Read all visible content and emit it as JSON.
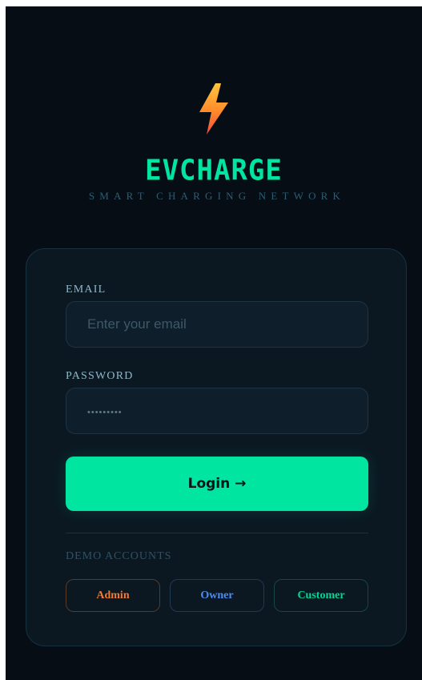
{
  "brand": {
    "logo_icon": "lightning-bolt-icon",
    "name": "EVCHARGE",
    "tagline": "SMART CHARGING NETWORK",
    "accent_color": "#00e5a0"
  },
  "login_form": {
    "email": {
      "label": "EMAIL",
      "value": "",
      "placeholder": "Enter your email"
    },
    "password": {
      "label": "PASSWORD",
      "value": "",
      "placeholder": "•••••••••"
    },
    "submit_label": "Login →"
  },
  "demo_accounts": {
    "label": "DEMO ACCOUNTS",
    "buttons": [
      {
        "label": "Admin",
        "color": "#f07b30"
      },
      {
        "label": "Owner",
        "color": "#4d8df0"
      },
      {
        "label": "Customer",
        "color": "#00d895"
      }
    ]
  }
}
